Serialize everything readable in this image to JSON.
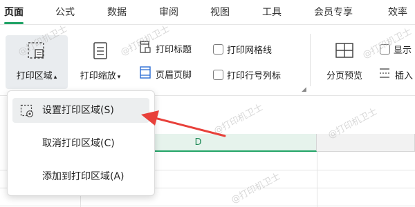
{
  "tabs": [
    {
      "label": "页面",
      "active": true
    },
    {
      "label": "公式"
    },
    {
      "label": "数据"
    },
    {
      "label": "审阅"
    },
    {
      "label": "视图"
    },
    {
      "label": "工具"
    },
    {
      "label": "会员专享"
    },
    {
      "label": "效率"
    }
  ],
  "ribbon": {
    "print_area": {
      "label": "打印区域",
      "icon": "print-area-icon"
    },
    "print_scale": {
      "label": "打印缩放",
      "icon": "print-scale-icon"
    },
    "print_title": {
      "label": "打印标题",
      "icon": "print-title-icon"
    },
    "header_footer": {
      "label": "页眉页脚",
      "icon": "header-footer-icon"
    },
    "print_gridlines": {
      "label": "打印网格线",
      "checked": false
    },
    "print_row_col_labels": {
      "label": "打印行号列标",
      "checked": false
    },
    "page_break_preview": {
      "label": "分页预览",
      "icon": "page-break-preview-icon"
    },
    "show": {
      "label": "显示",
      "checked": false
    },
    "insert": {
      "label": "插入",
      "icon": "insert-page-break-icon"
    }
  },
  "dropdown": {
    "items": [
      {
        "label": "设置打印区域(S)",
        "icon": "set-print-area-icon",
        "highlighted": true
      },
      {
        "label": "取消打印区域(C)"
      },
      {
        "label": "添加到打印区域(A)"
      }
    ]
  },
  "sheet": {
    "column_header": "D",
    "selected_column_color": "#21a366"
  },
  "watermark": {
    "text": "@打印机卫士"
  },
  "annotation": {
    "arrow_color": "#e8403a"
  },
  "colors": {
    "accent": "#21a366",
    "arrow": "#e8403a"
  }
}
